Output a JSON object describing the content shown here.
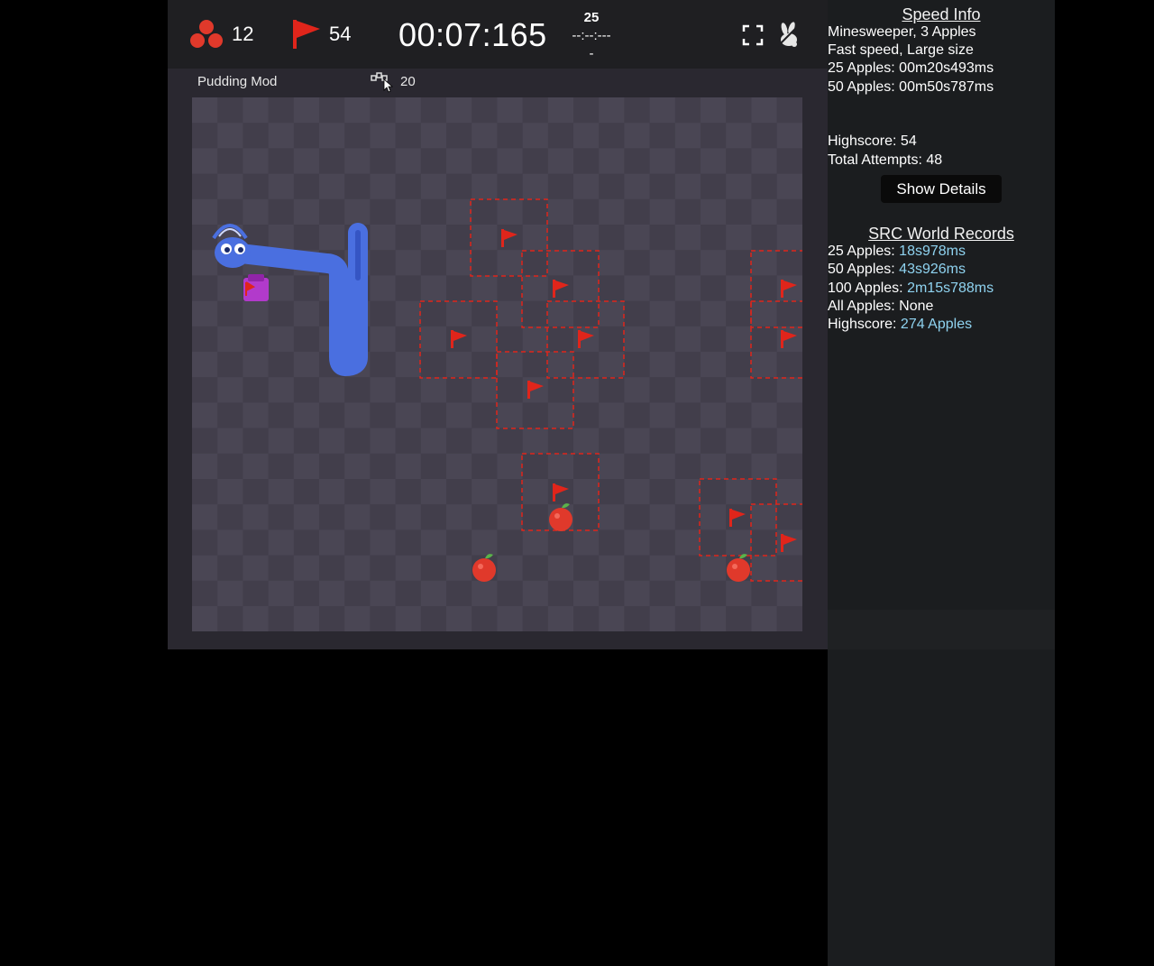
{
  "topbar": {
    "apples": {
      "icon": "apple-cluster-icon",
      "count": "12",
      "color": "#e0392b"
    },
    "flags": {
      "icon": "flag-icon",
      "count": "54",
      "color": "#e0392b"
    },
    "timer": "00:07:165",
    "target": {
      "goal": "25",
      "split": "--:--:---",
      "dash": "-"
    },
    "fullscreen_icon": "fullscreen-icon",
    "speed_icon": "rabbit-icon"
  },
  "mod": {
    "label": "Pudding Mod",
    "icon": "mod-blocks-icon",
    "count": "20"
  },
  "board": {
    "theme": {
      "light": "#4a4654",
      "dark": "#423e4b",
      "border": "#2a2830"
    },
    "snake_color": "#4a6fe0",
    "flag_color": "#e0251b",
    "apple_color": "#e0392b"
  },
  "sidebar": {
    "speed_title": "Speed Info",
    "mode": "Minesweeper, 3 Apples",
    "setting": "Fast speed, Large size",
    "pb25": "25 Apples: 00m20s493ms",
    "pb50": "50 Apples: 00m50s787ms",
    "highscore": "Highscore: 54",
    "attempts": "Total Attempts: 48",
    "details_button": "Show Details",
    "records_title": "SRC World Records",
    "records": [
      {
        "label": "25 Apples: ",
        "value": "18s978ms",
        "link": true
      },
      {
        "label": "50 Apples: ",
        "value": "43s926ms",
        "link": true
      },
      {
        "label": "100 Apples: ",
        "value": "2m15s788ms",
        "link": true
      },
      {
        "label": "All Apples: None",
        "value": "",
        "link": false
      },
      {
        "label": "Highscore: ",
        "value": "274 Apples",
        "link": true
      }
    ]
  }
}
